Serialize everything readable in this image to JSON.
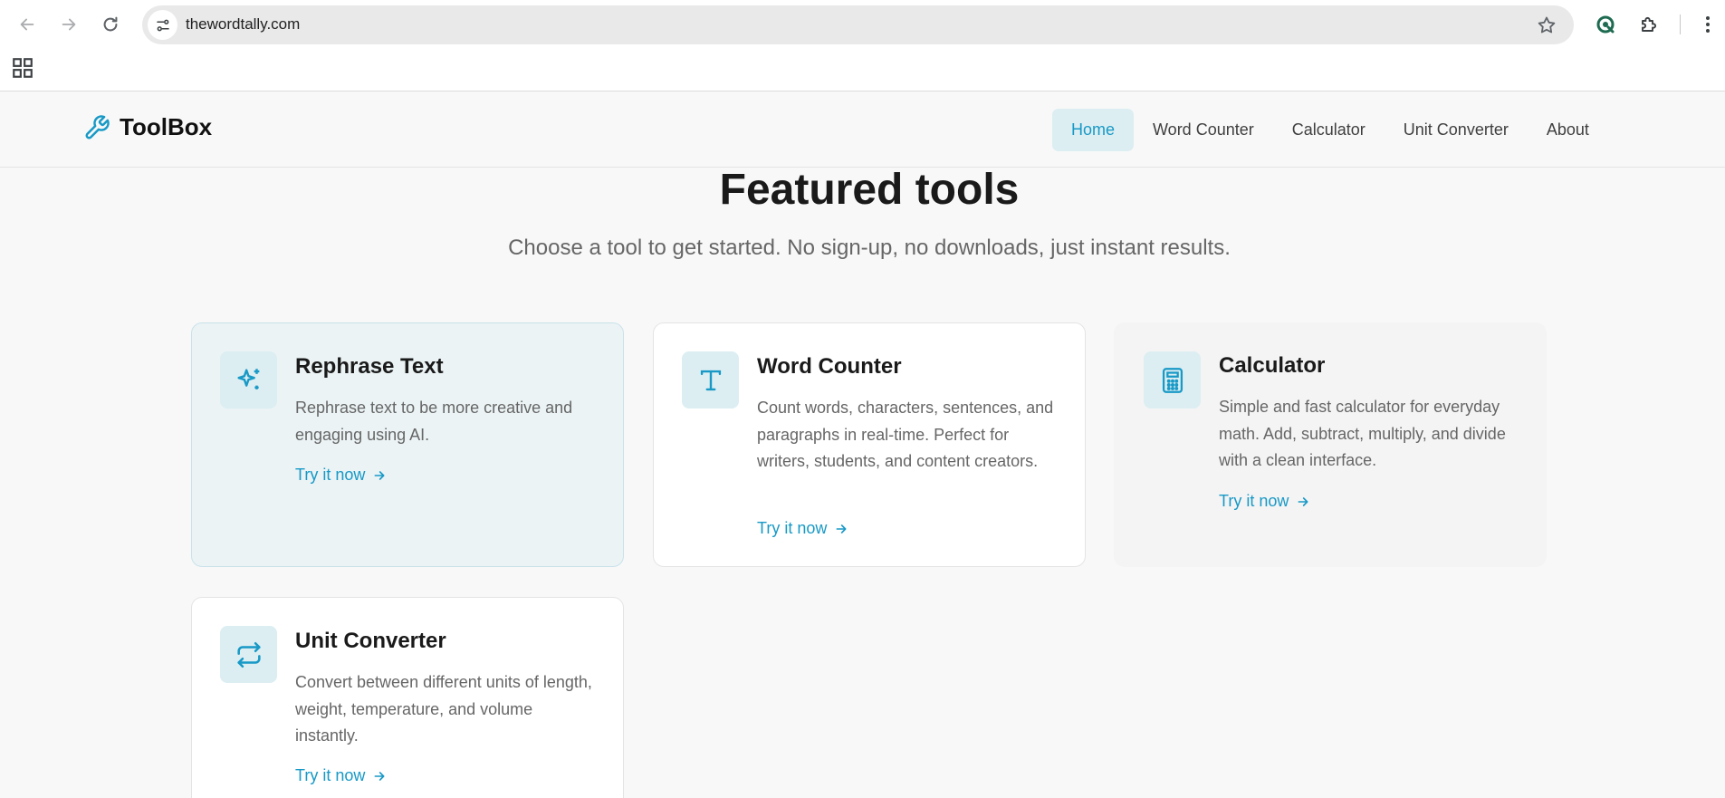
{
  "browser": {
    "url": "thewordtally.com"
  },
  "site": {
    "brand": "ToolBox",
    "nav": [
      {
        "label": "Home",
        "active": true
      },
      {
        "label": "Word Counter",
        "active": false
      },
      {
        "label": "Calculator",
        "active": false
      },
      {
        "label": "Unit Converter",
        "active": false
      },
      {
        "label": "About",
        "active": false
      }
    ]
  },
  "main": {
    "title": "Featured tools",
    "subtitle": "Choose a tool to get started. No sign-up, no downloads, just instant results.",
    "cards": [
      {
        "icon": "sparkles-icon",
        "title": "Rephrase Text",
        "description": "Rephrase text to be more creative and engaging using AI.",
        "link": "Try it now"
      },
      {
        "icon": "text-t-icon",
        "title": "Word Counter",
        "description": "Count words, characters, sentences, and paragraphs in real-time. Perfect for writers, students, and content creators.",
        "link": "Try it now"
      },
      {
        "icon": "calculator-icon",
        "title": "Calculator",
        "description": "Simple and fast calculator for everyday math. Add, subtract, multiply, and divide with a clean interface.",
        "link": "Try it now"
      },
      {
        "icon": "swap-arrows-icon",
        "title": "Unit Converter",
        "description": "Convert between different units of length, weight, temperature, and volume instantly.",
        "link": "Try it now"
      }
    ]
  },
  "colors": {
    "accent": "#1899c6",
    "accent_bg": "#dceef2",
    "page_bg": "#f8f8f8"
  }
}
